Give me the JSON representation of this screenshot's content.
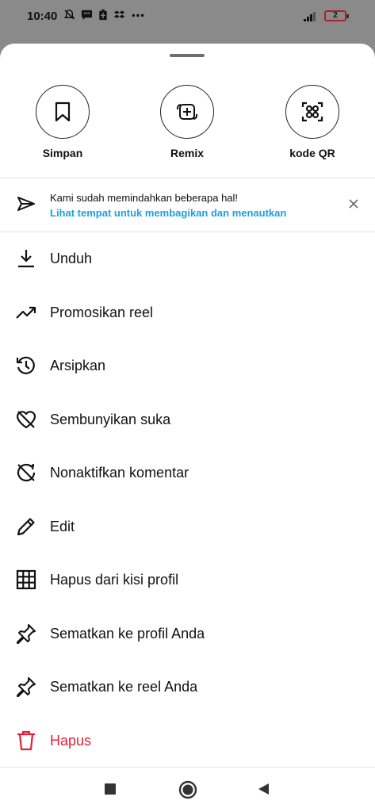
{
  "status_bar": {
    "time": "10:40",
    "battery": "2"
  },
  "top_actions": [
    {
      "label": "Simpan"
    },
    {
      "label": "Remix"
    },
    {
      "label": "kode QR"
    }
  ],
  "notice": {
    "text": "Kami sudah memindahkan beberapa hal!",
    "link": "Lihat tempat untuk membagikan dan menautkan"
  },
  "menu": [
    {
      "label": "Unduh",
      "icon": "download-icon"
    },
    {
      "label": "Promosikan reel",
      "icon": "trending-up-icon"
    },
    {
      "label": "Arsipkan",
      "icon": "archive-history-icon"
    },
    {
      "label": "Sembunyikan suka",
      "icon": "heart-off-icon"
    },
    {
      "label": "Nonaktifkan komentar",
      "icon": "comment-off-icon"
    },
    {
      "label": "Edit",
      "icon": "pencil-icon"
    },
    {
      "label": "Hapus dari kisi profil",
      "icon": "grid-icon"
    },
    {
      "label": "Sematkan ke profil Anda",
      "icon": "pin-icon"
    },
    {
      "label": "Sematkan ke reel Anda",
      "icon": "pin-icon"
    },
    {
      "label": "Hapus",
      "icon": "trash-icon"
    }
  ],
  "colors": {
    "link": "#1a9fe0",
    "danger": "#e0213a"
  }
}
